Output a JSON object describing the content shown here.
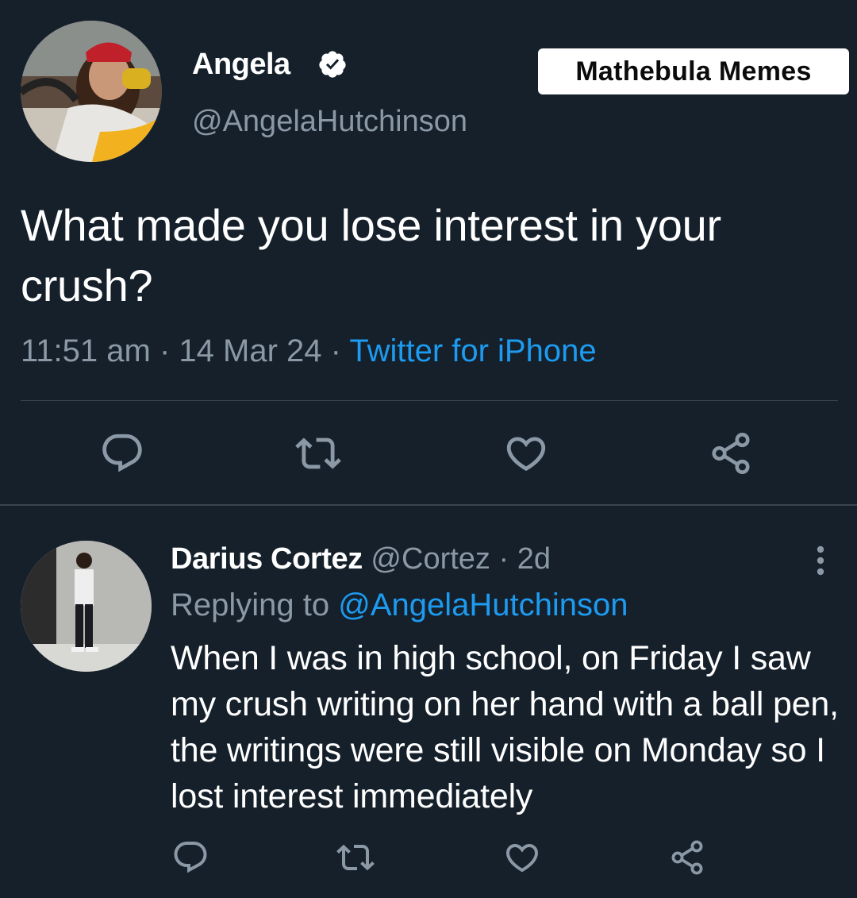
{
  "tweet": {
    "author_name": "Angela",
    "author_handle": "@AngelaHutchinson",
    "verified": true,
    "text": "What made you lose interest in your crush?",
    "time": "11:51 am",
    "date": "14 Mar 24",
    "separator": "·",
    "source": "Twitter for iPhone",
    "actions": [
      "reply-icon",
      "retweet-icon",
      "like-icon",
      "share-icon"
    ]
  },
  "watermark": {
    "text": "Mathebula Memes"
  },
  "reply": {
    "author_name": "Darius Cortez",
    "author_handle": "@Cortez",
    "age": "2d",
    "replying_prefix": "Replying to",
    "replying_to": "@AngelaHutchinson",
    "text": "When I was in high school, on Friday I saw my crush writing on her hand with a ball pen, the writings were still visible on Monday so I lost interest immediately",
    "actions": [
      "reply-icon",
      "retweet-icon",
      "like-icon",
      "share-icon"
    ]
  },
  "colors": {
    "background": "#15202b",
    "secondary_text": "#8b98a5",
    "link": "#1d9bf0",
    "divider": "#38444d"
  }
}
